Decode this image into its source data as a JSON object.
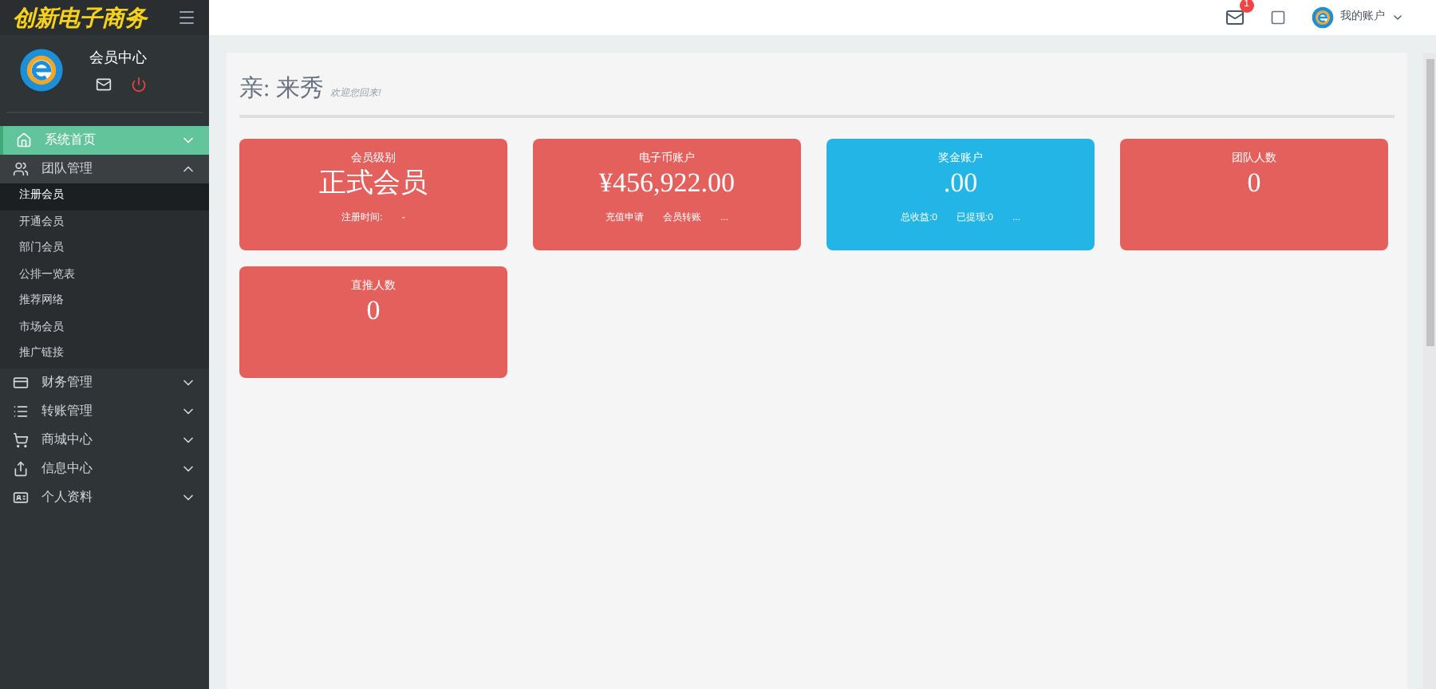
{
  "logo": "创新电子商务",
  "user_panel": {
    "title": "会员中心"
  },
  "topbar": {
    "mail_badge": "1",
    "account": "我的账户"
  },
  "sidebar": {
    "items": [
      {
        "label": "系统首页",
        "selected": true,
        "expanded": false
      },
      {
        "label": "团队管理",
        "selected": false,
        "expanded": true,
        "children": [
          {
            "label": "注册会员",
            "selected": true
          },
          {
            "label": "开通会员",
            "selected": false
          },
          {
            "label": "部门会员",
            "selected": false
          },
          {
            "label": "公排一览表",
            "selected": false
          },
          {
            "label": "推荐网络",
            "selected": false
          },
          {
            "label": "市场会员",
            "selected": false
          },
          {
            "label": "推广链接",
            "selected": false
          }
        ]
      },
      {
        "label": "财务管理",
        "selected": false,
        "expanded": false
      },
      {
        "label": "转账管理",
        "selected": false,
        "expanded": false
      },
      {
        "label": "商城中心",
        "selected": false,
        "expanded": false
      },
      {
        "label": "信息中心",
        "selected": false,
        "expanded": false
      },
      {
        "label": "个人资料",
        "selected": false,
        "expanded": false
      }
    ]
  },
  "greeting": {
    "prefix": "亲:",
    "name": "来秀",
    "note": "欢迎您回来!"
  },
  "cards": [
    {
      "title": "会员级别",
      "value": "正式会员",
      "color": "#e4605d",
      "links": [
        "注册时间:",
        "-"
      ]
    },
    {
      "title": "电子币账户",
      "value": "¥456,922.00",
      "color": "#e4605d",
      "links": [
        "充值申请",
        "会员转账",
        "..."
      ]
    },
    {
      "title": "奖金账户",
      "value": ".00",
      "color": "#22b5e6",
      "links": [
        "总收益:0",
        "已提现:0",
        "..."
      ]
    },
    {
      "title": "团队人数",
      "value": "0",
      "color": "#e4605d"
    },
    {
      "title": "直推人数",
      "value": "0",
      "color": "#e4605d"
    }
  ]
}
